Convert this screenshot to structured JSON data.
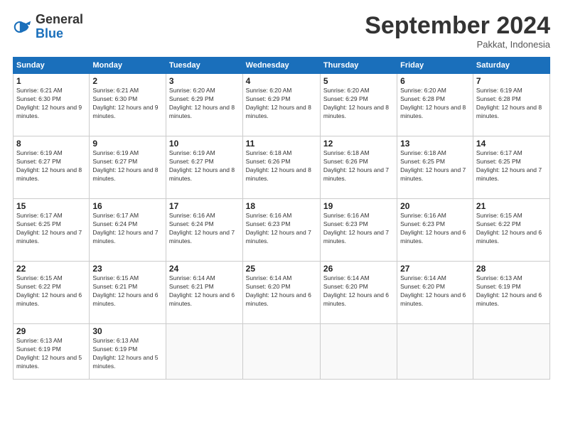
{
  "logo": {
    "general": "General",
    "blue": "Blue"
  },
  "title": "September 2024",
  "location": "Pakkat, Indonesia",
  "days_of_week": [
    "Sunday",
    "Monday",
    "Tuesday",
    "Wednesday",
    "Thursday",
    "Friday",
    "Saturday"
  ],
  "weeks": [
    [
      {
        "day": "1",
        "sunrise": "6:21 AM",
        "sunset": "6:30 PM",
        "daylight": "12 hours and 9 minutes."
      },
      {
        "day": "2",
        "sunrise": "6:21 AM",
        "sunset": "6:30 PM",
        "daylight": "12 hours and 9 minutes."
      },
      {
        "day": "3",
        "sunrise": "6:20 AM",
        "sunset": "6:29 PM",
        "daylight": "12 hours and 8 minutes."
      },
      {
        "day": "4",
        "sunrise": "6:20 AM",
        "sunset": "6:29 PM",
        "daylight": "12 hours and 8 minutes."
      },
      {
        "day": "5",
        "sunrise": "6:20 AM",
        "sunset": "6:29 PM",
        "daylight": "12 hours and 8 minutes."
      },
      {
        "day": "6",
        "sunrise": "6:20 AM",
        "sunset": "6:28 PM",
        "daylight": "12 hours and 8 minutes."
      },
      {
        "day": "7",
        "sunrise": "6:19 AM",
        "sunset": "6:28 PM",
        "daylight": "12 hours and 8 minutes."
      }
    ],
    [
      {
        "day": "8",
        "sunrise": "6:19 AM",
        "sunset": "6:27 PM",
        "daylight": "12 hours and 8 minutes."
      },
      {
        "day": "9",
        "sunrise": "6:19 AM",
        "sunset": "6:27 PM",
        "daylight": "12 hours and 8 minutes."
      },
      {
        "day": "10",
        "sunrise": "6:19 AM",
        "sunset": "6:27 PM",
        "daylight": "12 hours and 8 minutes."
      },
      {
        "day": "11",
        "sunrise": "6:18 AM",
        "sunset": "6:26 PM",
        "daylight": "12 hours and 8 minutes."
      },
      {
        "day": "12",
        "sunrise": "6:18 AM",
        "sunset": "6:26 PM",
        "daylight": "12 hours and 7 minutes."
      },
      {
        "day": "13",
        "sunrise": "6:18 AM",
        "sunset": "6:25 PM",
        "daylight": "12 hours and 7 minutes."
      },
      {
        "day": "14",
        "sunrise": "6:17 AM",
        "sunset": "6:25 PM",
        "daylight": "12 hours and 7 minutes."
      }
    ],
    [
      {
        "day": "15",
        "sunrise": "6:17 AM",
        "sunset": "6:25 PM",
        "daylight": "12 hours and 7 minutes."
      },
      {
        "day": "16",
        "sunrise": "6:17 AM",
        "sunset": "6:24 PM",
        "daylight": "12 hours and 7 minutes."
      },
      {
        "day": "17",
        "sunrise": "6:16 AM",
        "sunset": "6:24 PM",
        "daylight": "12 hours and 7 minutes."
      },
      {
        "day": "18",
        "sunrise": "6:16 AM",
        "sunset": "6:23 PM",
        "daylight": "12 hours and 7 minutes."
      },
      {
        "day": "19",
        "sunrise": "6:16 AM",
        "sunset": "6:23 PM",
        "daylight": "12 hours and 7 minutes."
      },
      {
        "day": "20",
        "sunrise": "6:16 AM",
        "sunset": "6:23 PM",
        "daylight": "12 hours and 6 minutes."
      },
      {
        "day": "21",
        "sunrise": "6:15 AM",
        "sunset": "6:22 PM",
        "daylight": "12 hours and 6 minutes."
      }
    ],
    [
      {
        "day": "22",
        "sunrise": "6:15 AM",
        "sunset": "6:22 PM",
        "daylight": "12 hours and 6 minutes."
      },
      {
        "day": "23",
        "sunrise": "6:15 AM",
        "sunset": "6:21 PM",
        "daylight": "12 hours and 6 minutes."
      },
      {
        "day": "24",
        "sunrise": "6:14 AM",
        "sunset": "6:21 PM",
        "daylight": "12 hours and 6 minutes."
      },
      {
        "day": "25",
        "sunrise": "6:14 AM",
        "sunset": "6:20 PM",
        "daylight": "12 hours and 6 minutes."
      },
      {
        "day": "26",
        "sunrise": "6:14 AM",
        "sunset": "6:20 PM",
        "daylight": "12 hours and 6 minutes."
      },
      {
        "day": "27",
        "sunrise": "6:14 AM",
        "sunset": "6:20 PM",
        "daylight": "12 hours and 6 minutes."
      },
      {
        "day": "28",
        "sunrise": "6:13 AM",
        "sunset": "6:19 PM",
        "daylight": "12 hours and 6 minutes."
      }
    ],
    [
      {
        "day": "29",
        "sunrise": "6:13 AM",
        "sunset": "6:19 PM",
        "daylight": "12 hours and 5 minutes."
      },
      {
        "day": "30",
        "sunrise": "6:13 AM",
        "sunset": "6:19 PM",
        "daylight": "12 hours and 5 minutes."
      },
      null,
      null,
      null,
      null,
      null
    ]
  ]
}
